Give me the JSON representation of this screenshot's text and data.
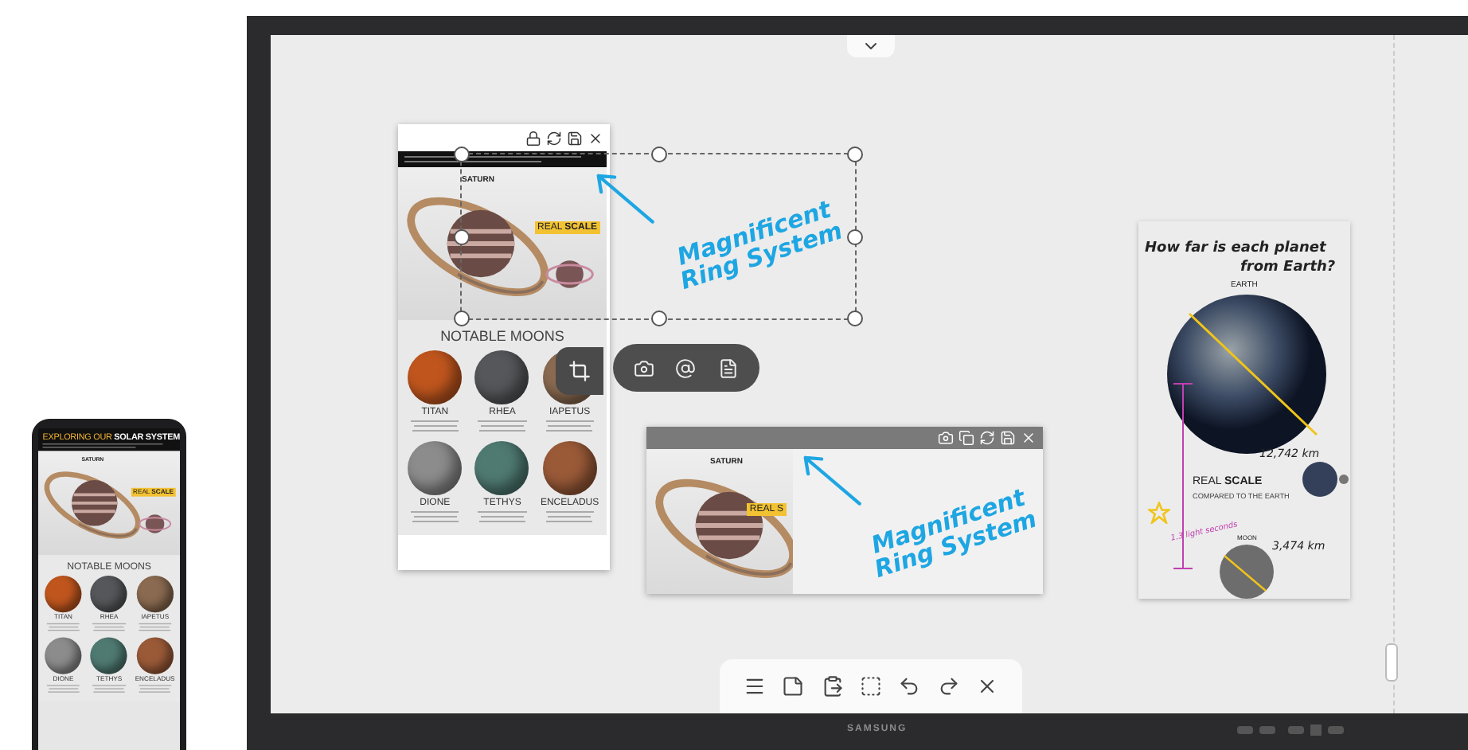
{
  "phone": {
    "title": "EXPLORING OUR **SOLAR SYSTEM**",
    "planet_label": "SATURN",
    "badge": "REAL **SCALE**",
    "section_title": "NOTABLE MOONS",
    "moons": [
      {
        "name": "TITAN",
        "color": "#c0561e"
      },
      {
        "name": "RHEA",
        "color": "#55575a"
      },
      {
        "name": "IAPETUS",
        "color": "#8a6a50"
      },
      {
        "name": "DIONE",
        "color": "#8c8c8c"
      },
      {
        "name": "TETHYS",
        "color": "#4f7a72"
      },
      {
        "name": "ENCELADUS",
        "color": "#9a5a38"
      }
    ]
  },
  "document_window": {
    "planet_label": "SATURN",
    "badge": "REAL **SCALE**",
    "section_title": "NOTABLE MOONS",
    "moons": [
      {
        "name": "TITAN",
        "color": "#c0561e"
      },
      {
        "name": "RHEA",
        "color": "#55575a"
      },
      {
        "name": "IAPETUS",
        "color": "#8a6a50"
      },
      {
        "name": "DIONE",
        "color": "#8c8c8c"
      },
      {
        "name": "TETHYS",
        "color": "#4f7a72"
      },
      {
        "name": "ENCELADUS",
        "color": "#9a5a38"
      }
    ]
  },
  "selection": {
    "note": "Magnificent Ring System"
  },
  "clip_window": {
    "planet_label": "SATURN",
    "badge": "REAL S",
    "note": "Magnificent Ring System"
  },
  "poster": {
    "headline": "How far is each planet",
    "headline_2": "from Earth?",
    "earth_label": "EARTH",
    "earth_diameter": "12,742 km",
    "badge": "REAL **SCALE**",
    "badge_sub": "COMPARED TO THE EARTH",
    "distance": "1.3 light seconds",
    "moon_label": "MOON",
    "moon_diameter": "3,474 km"
  },
  "display": {
    "brand": "SAMSUNG"
  }
}
